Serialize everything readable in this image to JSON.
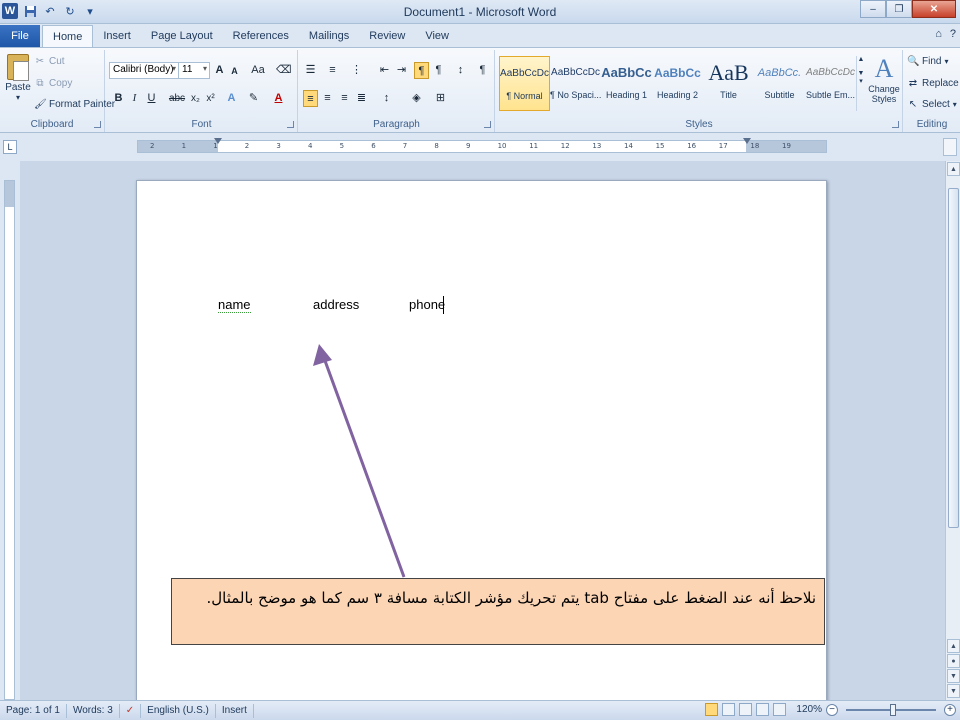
{
  "titlebar": {
    "title": "Document1 - Microsoft Word",
    "app_icon": "W",
    "qat": [
      "save-icon",
      "undo-icon",
      "redo-icon"
    ],
    "controls": [
      "minimize-icon",
      "restore-icon",
      "close-icon"
    ]
  },
  "tabs": {
    "file": "File",
    "items": [
      "Home",
      "Insert",
      "Page Layout",
      "References",
      "Mailings",
      "Review",
      "View"
    ],
    "active": "Home"
  },
  "ribbon": {
    "clipboard": {
      "label": "Clipboard",
      "paste": "Paste",
      "cut": "Cut",
      "copy": "Copy",
      "format_painter": "Format Painter"
    },
    "font": {
      "label": "Font",
      "font_name": "Calibri (Body)",
      "font_size": "11",
      "grow": "A",
      "shrink": "A",
      "case": "Aa",
      "bold": "B",
      "italic": "I",
      "underline": "U",
      "strike": "abc",
      "subscript": "x₂",
      "superscript": "x²",
      "font_color": "A"
    },
    "paragraph": {
      "label": "Paragraph",
      "show_marks": "¶"
    },
    "styles": {
      "label": "Styles",
      "items": [
        {
          "preview": "AaBbCcDc",
          "name": "¶ Normal"
        },
        {
          "preview": "AaBbCcDc",
          "name": "¶ No Spaci..."
        },
        {
          "preview": "AaBbCc",
          "name": "Heading 1"
        },
        {
          "preview": "AaBbCc",
          "name": "Heading 2"
        },
        {
          "preview": "AaB",
          "name": "Title"
        },
        {
          "preview": "AaBbCc.",
          "name": "Subtitle"
        },
        {
          "preview": "AaBbCcDc",
          "name": "Subtle Em..."
        }
      ],
      "change_styles": "Change Styles",
      "change_styles_line1": "Change",
      "change_styles_line2": "Styles"
    },
    "editing": {
      "label": "Editing",
      "find": "Find",
      "replace": "Replace",
      "select": "Select"
    }
  },
  "ruler": {
    "ticks": [
      "2",
      "1",
      "1",
      "2",
      "3",
      "4",
      "5",
      "6",
      "7",
      "8",
      "9",
      "10",
      "11",
      "12",
      "13",
      "14",
      "15",
      "16",
      "17",
      "18",
      "19"
    ]
  },
  "document": {
    "words": [
      "name",
      "address",
      "phone"
    ]
  },
  "callout": {
    "text": "نلاحظ أنه عند الضغط على مفتاح tab يتم تحريك مؤشر الكتابة مسافة ٣ سم كما هو موضح بالمثال."
  },
  "statusbar": {
    "page": "Page: 1 of 1",
    "words": "Words: 3",
    "language": "English (U.S.)",
    "mode": "Insert",
    "zoom": "120%",
    "zoom_level_percent": 120
  }
}
